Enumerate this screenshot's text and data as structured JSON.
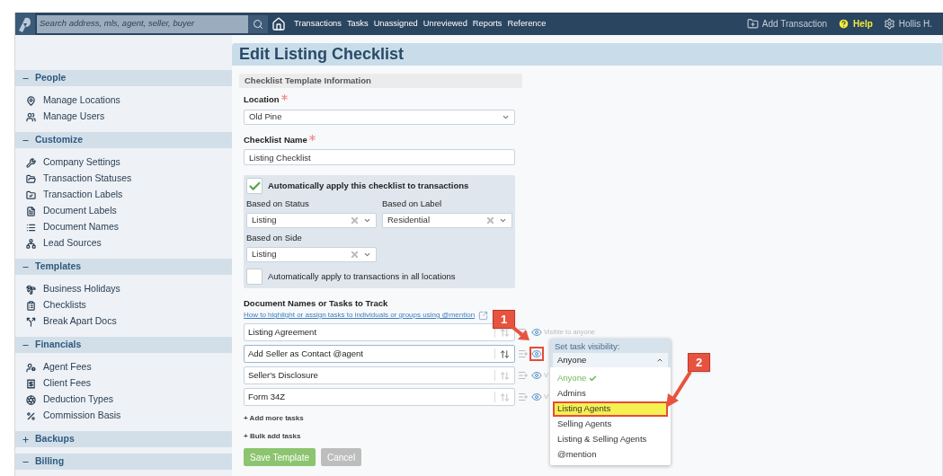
{
  "top_bar": {
    "search": {
      "placeholder": "Search address, mls, agent, seller, buyer"
    },
    "nav": [
      "Transactions",
      "Tasks",
      "Unassigned",
      "Unreviewed",
      "Reports",
      "Reference"
    ],
    "actions": [
      {
        "kind": "add",
        "label": "Add Transaction"
      },
      {
        "kind": "help",
        "label": "Help"
      },
      {
        "kind": "user",
        "label": "Hollis H."
      }
    ]
  },
  "sidebar": {
    "sections": [
      {
        "title": "People",
        "expanded": true,
        "items": [
          "Manage Locations",
          "Manage Users"
        ]
      },
      {
        "title": "Customize",
        "expanded": true,
        "items": [
          "Company Settings",
          "Transaction Statuses",
          "Transaction Labels",
          "Document Labels",
          "Document Names",
          "Lead Sources"
        ]
      },
      {
        "title": "Templates",
        "expanded": true,
        "items": [
          "Business Holidays",
          "Checklists",
          "Break Apart Docs"
        ]
      },
      {
        "title": "Financials",
        "expanded": true,
        "items": [
          "Agent Fees",
          "Client Fees",
          "Deduction Types",
          "Commission Basis"
        ]
      },
      {
        "title": "Backups",
        "expanded": false
      },
      {
        "title": "Billing",
        "expanded": true
      }
    ]
  },
  "page": {
    "title": "Edit Listing Checklist"
  },
  "form": {
    "section_title": "Checklist Template Information",
    "location": {
      "label": "Location",
      "required": true,
      "value": "Old Pine"
    },
    "checklist_name": {
      "label": "Checklist Name",
      "required": true,
      "value": "Listing Checklist"
    },
    "auto_apply": {
      "label": "Automatically apply this checklist to transactions",
      "checked": true,
      "filters": [
        {
          "label": "Based on Status",
          "value": "Listing"
        },
        {
          "label": "Based on Label",
          "value": "Residential"
        },
        {
          "label": "Based on Side",
          "value": "Listing"
        }
      ],
      "all_locations": {
        "label": "Automatically apply to transactions in all locations",
        "checked": false
      }
    },
    "tasks": {
      "title": "Document Names or Tasks to Track",
      "help_link": "How to highlight or assign tasks to individuals or groups using @mention",
      "items": [
        {
          "value": "Listing Agreement",
          "visibility": "Visible to anyone",
          "focused": false
        },
        {
          "value": "Add Seller as Contact @agent",
          "focused": true
        },
        {
          "value": "Seller's Disclosure",
          "visibility": "V",
          "focused": false
        },
        {
          "value": "Form 34Z",
          "visibility": "V",
          "focused": false
        }
      ]
    },
    "add_links": [
      "+ Add more tasks",
      "+ Bulk add tasks"
    ],
    "buttons": [
      {
        "kind": "primary",
        "label": "Save Template"
      },
      {
        "kind": "secondary",
        "label": "Cancel"
      }
    ]
  },
  "visibility_popup": {
    "title": "Set task visibility:",
    "value": "Anyone",
    "options": [
      {
        "label": "Anyone",
        "checked": true,
        "highlighted": false
      },
      {
        "label": "Admins",
        "checked": false,
        "highlighted": false
      },
      {
        "label": "Listing Agents",
        "checked": false,
        "highlighted": true
      },
      {
        "label": "Selling Agents",
        "checked": false,
        "highlighted": false
      },
      {
        "label": "Listing & Selling Agents",
        "checked": false,
        "highlighted": false
      },
      {
        "label": "@mention",
        "checked": false,
        "highlighted": false
      }
    ]
  },
  "annotations": [
    "1",
    "2"
  ]
}
